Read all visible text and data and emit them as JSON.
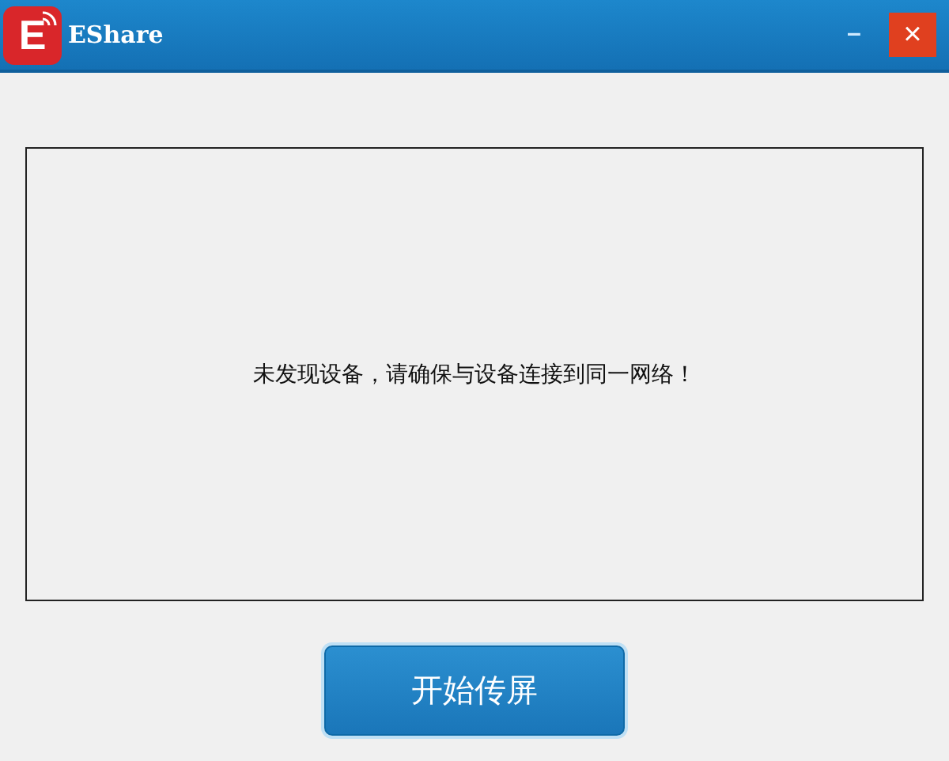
{
  "window": {
    "logo_letter": "E",
    "title": "EShare",
    "minimize": "–",
    "close": "×"
  },
  "device_panel": {
    "message": "未发现设备，请确保与设备连接到同一网络！"
  },
  "start_button": {
    "label": "开始传屏"
  }
}
